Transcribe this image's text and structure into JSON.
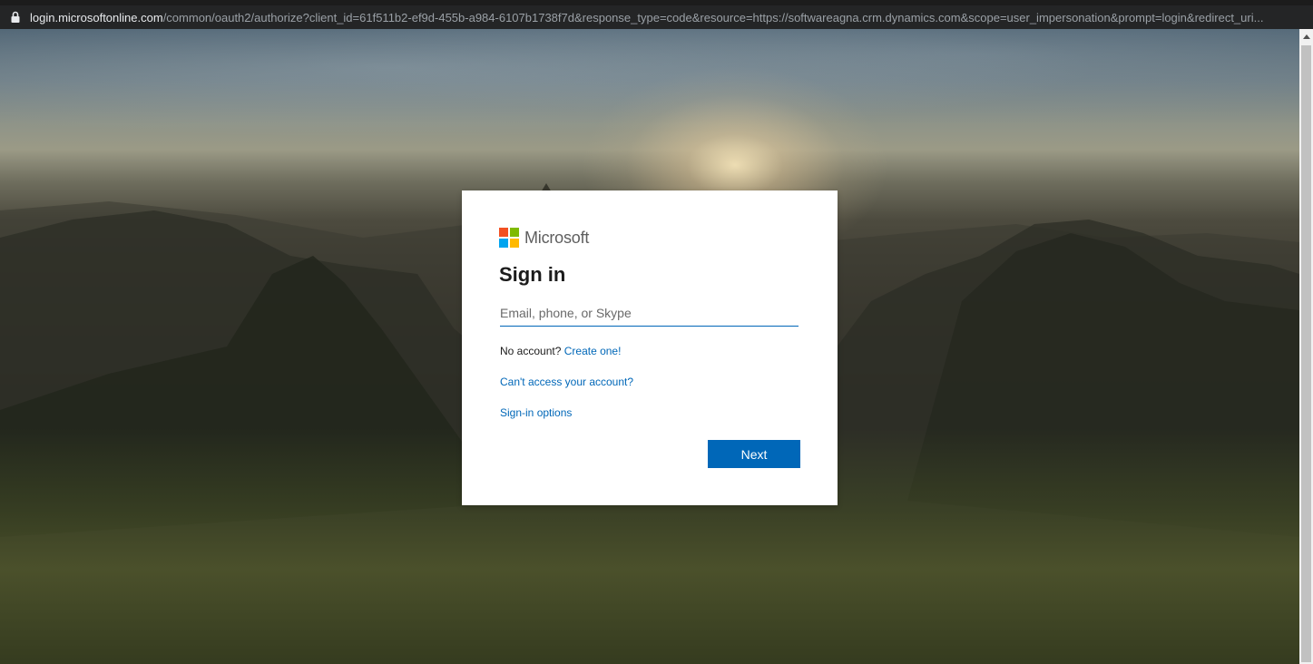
{
  "browser": {
    "url_host": "login.microsoftonline.com",
    "url_path": "/common/oauth2/authorize?client_id=61f511b2-ef9d-455b-a984-6107b1738f7d&response_type=code&resource=https://softwareagna.crm.dynamics.com&scope=user_impersonation&prompt=login&redirect_uri..."
  },
  "brand": {
    "name": "Microsoft",
    "logo_colors": [
      "#f25022",
      "#7fba00",
      "#00a4ef",
      "#ffb900"
    ]
  },
  "signin": {
    "title": "Sign in",
    "email_placeholder": "Email, phone, or Skype",
    "email_value": "",
    "no_account_text": "No account?",
    "create_link": "Create one!",
    "cant_access_link": "Can't access your account?",
    "options_link": "Sign-in options",
    "next_label": "Next"
  },
  "colors": {
    "accent": "#0067b8",
    "card_bg": "#ffffff"
  }
}
